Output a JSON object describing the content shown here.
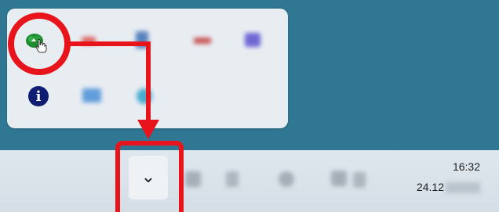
{
  "window": {
    "title": ""
  },
  "tray_popup": {
    "icons": [
      {
        "name": "green-cloud-app-icon",
        "blurred": false,
        "color": "#1f8a2e"
      },
      {
        "name": "red-app-icon",
        "blurred": true,
        "color": "#d85050"
      },
      {
        "name": "blue-document-icon",
        "blurred": true,
        "color": "#3f6fb5"
      },
      {
        "name": "red-bar-app-icon",
        "blurred": true,
        "color": "#c23a3a"
      },
      {
        "name": "purple-folder-icon",
        "blurred": true,
        "color": "#5b4fd0"
      },
      {
        "name": "info-icon",
        "blurred": false,
        "glyph": "i",
        "color": "#0f1d73"
      },
      {
        "name": "monitor-icon",
        "blurred": true,
        "color": "#4a8fd8"
      },
      {
        "name": "globe-icon",
        "blurred": true,
        "color": "#2aa0c8"
      }
    ]
  },
  "taskbar": {
    "show_hidden_icons_glyph": "⌄",
    "clock": {
      "time": "16:32",
      "date": "24.12"
    }
  },
  "annotation": {
    "color": "#e8141c"
  },
  "colors": {
    "desktop": "#2f7792",
    "taskbar": "#dbe3ea",
    "popup": "#e8edf2",
    "annotation": "#e8141c"
  }
}
